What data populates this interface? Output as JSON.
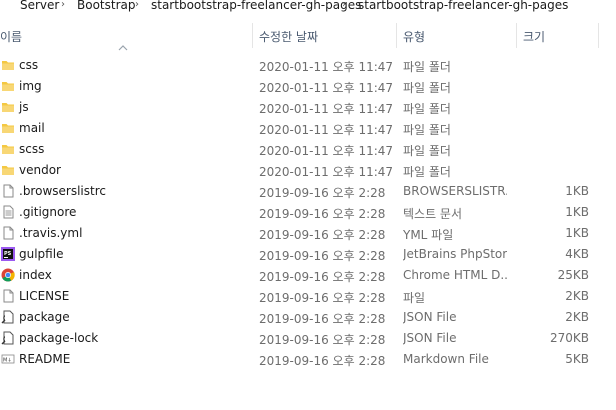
{
  "breadcrumb": [
    "Server",
    "Bootstrap",
    "startbootstrap-freelancer-gh-pages",
    "startbootstrap-freelancer-gh-pages"
  ],
  "columns": {
    "name": "이름",
    "date": "수정한 날짜",
    "type": "유형",
    "size": "크기"
  },
  "sort": {
    "column": "name",
    "direction": "ascending"
  },
  "files": [
    {
      "name": "css",
      "date": "2020-01-11 오후 11:47",
      "type": "파일 폴더",
      "size": "",
      "icon": "folder-icon"
    },
    {
      "name": "img",
      "date": "2020-01-11 오후 11:47",
      "type": "파일 폴더",
      "size": "",
      "icon": "folder-icon"
    },
    {
      "name": "js",
      "date": "2020-01-11 오후 11:47",
      "type": "파일 폴더",
      "size": "",
      "icon": "folder-icon"
    },
    {
      "name": "mail",
      "date": "2020-01-11 오후 11:47",
      "type": "파일 폴더",
      "size": "",
      "icon": "folder-icon"
    },
    {
      "name": "scss",
      "date": "2020-01-11 오후 11:47",
      "type": "파일 폴더",
      "size": "",
      "icon": "folder-icon"
    },
    {
      "name": "vendor",
      "date": "2020-01-11 오후 11:47",
      "type": "파일 폴더",
      "size": "",
      "icon": "folder-icon"
    },
    {
      "name": ".browserslistrc",
      "date": "2019-09-16 오후 2:28",
      "type": "BROWSERSLISTR...",
      "size": "1KB",
      "icon": "blank-file-icon"
    },
    {
      "name": ".gitignore",
      "date": "2019-09-16 오후 2:28",
      "type": "텍스트 문서",
      "size": "1KB",
      "icon": "text-file-icon"
    },
    {
      "name": ".travis.yml",
      "date": "2019-09-16 오후 2:28",
      "type": "YML 파일",
      "size": "1KB",
      "icon": "blank-file-icon"
    },
    {
      "name": "gulpfile",
      "date": "2019-09-16 오후 2:28",
      "type": "JetBrains PhpStorm",
      "size": "4KB",
      "icon": "phpstorm-icon"
    },
    {
      "name": "index",
      "date": "2019-09-16 오후 2:28",
      "type": "Chrome HTML D...",
      "size": "25KB",
      "icon": "chrome-icon"
    },
    {
      "name": "LICENSE",
      "date": "2019-09-16 오후 2:28",
      "type": "파일",
      "size": "2KB",
      "icon": "blank-file-icon"
    },
    {
      "name": "package",
      "date": "2019-09-16 오후 2:28",
      "type": "JSON File",
      "size": "2KB",
      "icon": "json-file-icon"
    },
    {
      "name": "package-lock",
      "date": "2019-09-16 오후 2:28",
      "type": "JSON File",
      "size": "270KB",
      "icon": "json-file-icon"
    },
    {
      "name": "README",
      "date": "2019-09-16 오후 2:28",
      "type": "Markdown File",
      "size": "5KB",
      "icon": "markdown-file-icon"
    }
  ],
  "colors": {
    "folder": "#f4c842",
    "header_text": "#4a5a70",
    "meta_text": "#6d6d6d",
    "phpstorm": "#9b59f0",
    "chrome_red": "#db4437",
    "chrome_yellow": "#f4b400",
    "chrome_green": "#0f9d58",
    "chrome_blue": "#4285f4"
  }
}
